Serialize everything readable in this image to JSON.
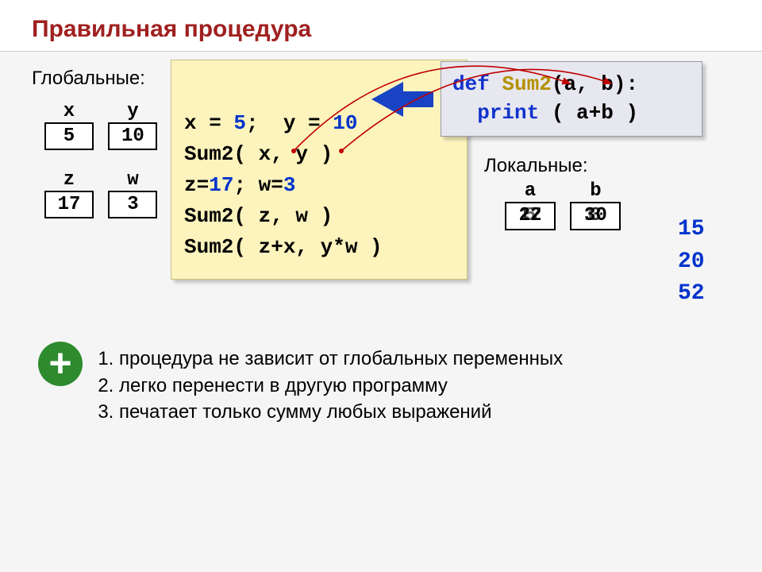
{
  "title": "Правильная процедура",
  "globals_label": "Глобальные:",
  "locals_label": "Локальные:",
  "vars": {
    "x": {
      "name": "x",
      "value": "5"
    },
    "y": {
      "name": "y",
      "value": "10"
    },
    "z": {
      "name": "z",
      "value": "17"
    },
    "w": {
      "name": "w",
      "value": "3"
    },
    "a": {
      "name": "a",
      "v1": "5",
      "v2": "17",
      "v3": "22"
    },
    "b": {
      "name": "b",
      "v1": "10",
      "v2": "3",
      "v3": "30"
    }
  },
  "def": {
    "kw": "def",
    "name": "Sum2",
    "params": "(a, b):",
    "print": "print",
    "body": "( a+b )"
  },
  "main": {
    "l1a": "x = ",
    "l1n1": "5",
    "l1b": ";  y = ",
    "l1n2": "10",
    "l2": "Sum2( x, y )",
    "l3a": "z=",
    "l3n1": "17",
    "l3b": "; w=",
    "l3n2": "3",
    "l4": "Sum2( z, w )",
    "l5": "Sum2( z+x, y*w )"
  },
  "outputs": [
    "15",
    "20",
    "52"
  ],
  "points": [
    "процедура не зависит от глобальных переменных",
    "легко перенести в другую программу",
    "печатает только сумму любых выражений"
  ]
}
